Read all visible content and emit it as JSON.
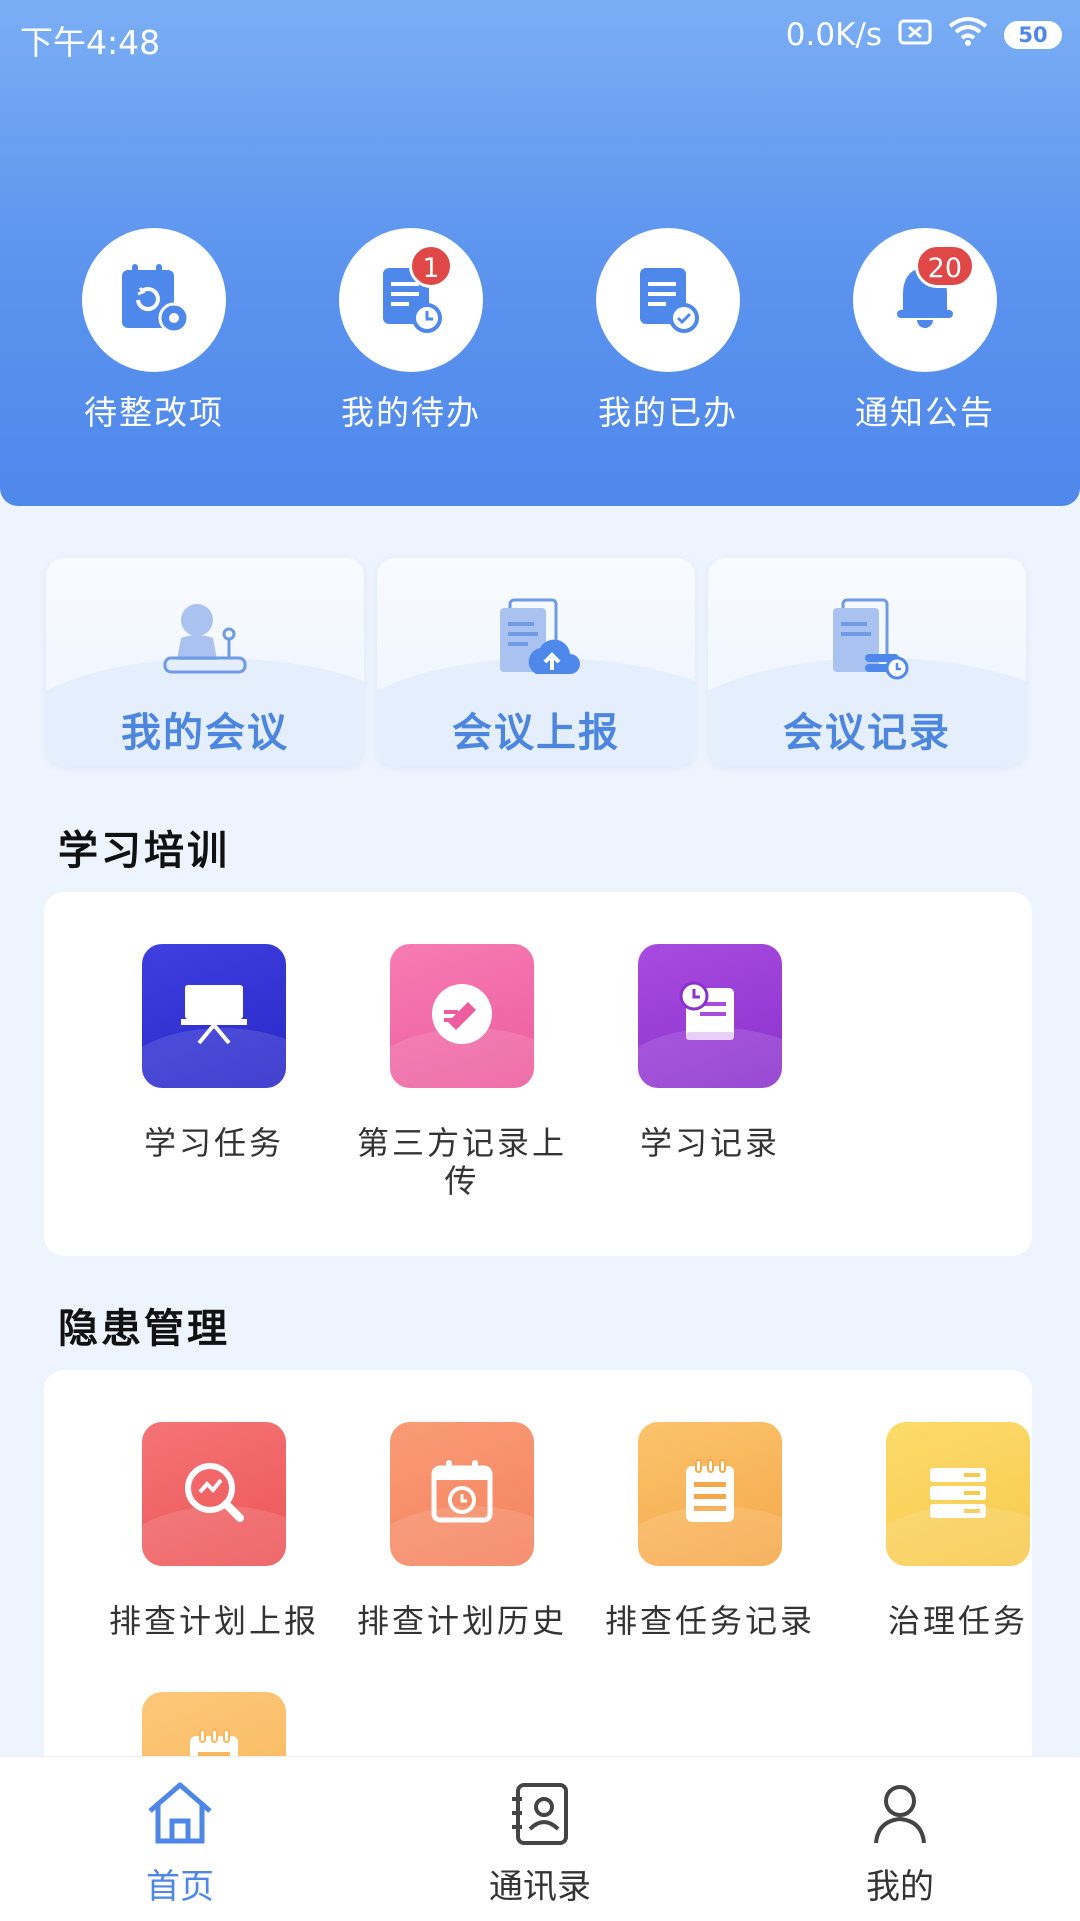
{
  "status_bar": {
    "time": "下午4:48",
    "speed": "0.0K/s",
    "battery": "50"
  },
  "quick_actions": [
    {
      "label": "待整改项",
      "icon": "calendar-gear-icon",
      "badge": null
    },
    {
      "label": "我的待办",
      "icon": "document-clock-icon",
      "badge": "1"
    },
    {
      "label": "我的已办",
      "icon": "document-check-icon",
      "badge": null
    },
    {
      "label": "通知公告",
      "icon": "bell-icon",
      "badge": "20"
    }
  ],
  "meeting_cards": [
    {
      "label": "我的会议",
      "icon": "person-stamp-icon"
    },
    {
      "label": "会议上报",
      "icon": "document-upload-icon"
    },
    {
      "label": "会议记录",
      "icon": "document-record-icon"
    }
  ],
  "study_section": {
    "title": "学习培训",
    "items": [
      {
        "label": "学习任务",
        "icon": "presentation-board-icon"
      },
      {
        "label": "第三方记录上传",
        "icon": "pencil-circle-icon"
      },
      {
        "label": "学习记录",
        "icon": "book-clock-icon"
      }
    ]
  },
  "hazard_section": {
    "title": "隐患管理",
    "items": [
      {
        "label": "排查计划上报",
        "icon": "magnifier-chart-icon"
      },
      {
        "label": "排查计划历史",
        "icon": "calendar-history-icon"
      },
      {
        "label": "排查任务记录",
        "icon": "notepad-icon"
      },
      {
        "label": "治理任务",
        "icon": "stacked-bars-icon"
      },
      {
        "label": "",
        "icon": "notepad-icon"
      }
    ]
  },
  "bottom_nav": [
    {
      "label": "首页",
      "icon": "home-icon",
      "active": true
    },
    {
      "label": "通讯录",
      "icon": "contacts-icon",
      "active": false
    },
    {
      "label": "我的",
      "icon": "user-icon",
      "active": false
    }
  ],
  "colors": {
    "header": "#5b93ee",
    "accent": "#4d86e6",
    "badge": "#e04848",
    "tile_blue": "#3535d6",
    "tile_pink": "#f26aa8",
    "tile_purple": "#9b3fd6",
    "tile_red": "#f06466",
    "tile_orange": "#f7906a",
    "tile_amber": "#f8b75a",
    "tile_yellow": "#fad45e"
  }
}
